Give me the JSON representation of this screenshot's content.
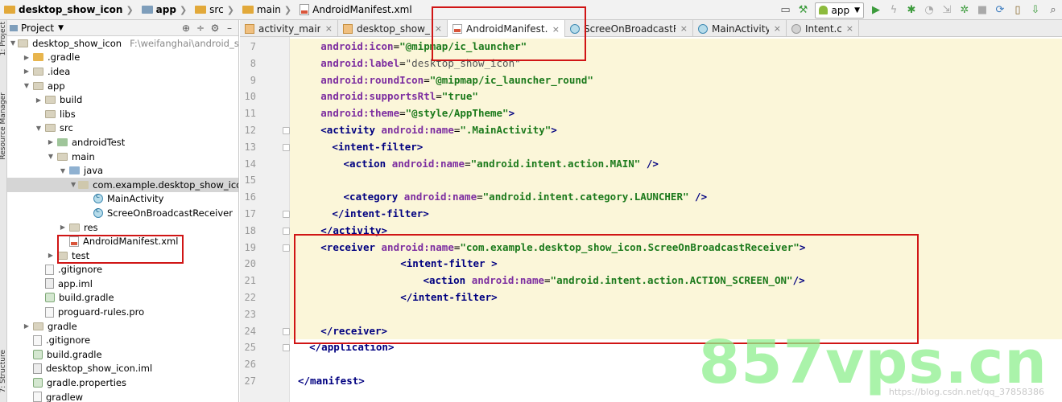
{
  "breadcrumb": [
    {
      "label": "desktop_show_icon",
      "icon": "project-folder-icon"
    },
    {
      "label": "app",
      "icon": "module-folder-icon"
    },
    {
      "label": "src",
      "icon": "folder-icon"
    },
    {
      "label": "main",
      "icon": "folder-icon"
    },
    {
      "label": "AndroidManifest.xml",
      "icon": "xml-file-icon"
    }
  ],
  "run_config": {
    "label": "app"
  },
  "project_panel": {
    "title": "Project",
    "tree": [
      {
        "label": "desktop_show_icon",
        "path": "F:\\weifanghai\\android_studio_ap",
        "icon": "folder",
        "arrow": "down",
        "indent": 0
      },
      {
        "label": ".gradle",
        "icon": "foldy",
        "arrow": "right",
        "indent": 1
      },
      {
        "label": ".idea",
        "icon": "fold",
        "arrow": "right",
        "indent": 1
      },
      {
        "label": "app",
        "icon": "fold",
        "arrow": "down",
        "indent": 1
      },
      {
        "label": "build",
        "icon": "fold",
        "arrow": "right",
        "indent": 2
      },
      {
        "label": "libs",
        "icon": "fold",
        "arrow": "none",
        "indent": 2
      },
      {
        "label": "src",
        "icon": "fold",
        "arrow": "down",
        "indent": 2
      },
      {
        "label": "androidTest",
        "icon": "foldg",
        "arrow": "right",
        "indent": 3
      },
      {
        "label": "main",
        "icon": "fold",
        "arrow": "down",
        "indent": 3
      },
      {
        "label": "java",
        "icon": "foldb",
        "arrow": "down",
        "indent": 4
      },
      {
        "label": "com.example.desktop_show_icon",
        "icon": "pkg",
        "arrow": "down",
        "indent": 5,
        "selected": true
      },
      {
        "label": "MainActivity",
        "icon": "cls",
        "arrow": "none",
        "indent": 6
      },
      {
        "label": "ScreeOnBroadcastReceiver",
        "icon": "cls",
        "arrow": "none",
        "indent": 6
      },
      {
        "label": "res",
        "icon": "fold",
        "arrow": "right",
        "indent": 4
      },
      {
        "label": "AndroidManifest.xml",
        "icon": "xml",
        "arrow": "none",
        "indent": 4
      },
      {
        "label": "test",
        "icon": "fold",
        "arrow": "right",
        "indent": 3
      },
      {
        "label": ".gitignore",
        "icon": "file",
        "arrow": "none",
        "indent": 2
      },
      {
        "label": "app.iml",
        "icon": "iml",
        "arrow": "none",
        "indent": 2
      },
      {
        "label": "build.gradle",
        "icon": "gradle",
        "arrow": "none",
        "indent": 2
      },
      {
        "label": "proguard-rules.pro",
        "icon": "file",
        "arrow": "none",
        "indent": 2
      },
      {
        "label": "gradle",
        "icon": "fold",
        "arrow": "right",
        "indent": 1
      },
      {
        "label": ".gitignore",
        "icon": "file",
        "arrow": "none",
        "indent": 1
      },
      {
        "label": "build.gradle",
        "icon": "gradle",
        "arrow": "none",
        "indent": 1
      },
      {
        "label": "desktop_show_icon.iml",
        "icon": "iml",
        "arrow": "none",
        "indent": 1
      },
      {
        "label": "gradle.properties",
        "icon": "gradle",
        "arrow": "none",
        "indent": 1
      },
      {
        "label": "gradlew",
        "icon": "file",
        "arrow": "none",
        "indent": 1
      }
    ]
  },
  "left_strip": {
    "project_tab": "1: Project",
    "resource_tab": "Resource Manager",
    "structure_tab": "7: Structure"
  },
  "tabs": [
    {
      "label": "activity_main.xml",
      "icon": "act"
    },
    {
      "label": "desktop_show_icon",
      "icon": "act"
    },
    {
      "label": "AndroidManifest.xml",
      "icon": "xml",
      "active": true
    },
    {
      "label": "ScreeOnBroadcastReceiver.java",
      "icon": "cls"
    },
    {
      "label": "MainActivity.java",
      "icon": "cls"
    },
    {
      "label": "Intent.class",
      "icon": "intent"
    }
  ],
  "code_lines": [
    {
      "n": "7",
      "indent": 4,
      "parts": [
        [
          "attr",
          "android:icon"
        ],
        [
          "txt",
          "="
        ],
        [
          "val",
          "\"@mipmap/ic_launcher\""
        ]
      ]
    },
    {
      "n": "8",
      "indent": 4,
      "parts": [
        [
          "attr",
          "android:label"
        ],
        [
          "txt",
          "="
        ],
        [
          "gray",
          "\"desktop_show_icon\""
        ]
      ]
    },
    {
      "n": "9",
      "indent": 4,
      "parts": [
        [
          "attr",
          "android:roundIcon"
        ],
        [
          "txt",
          "="
        ],
        [
          "val",
          "\"@mipmap/ic_launcher_round\""
        ]
      ]
    },
    {
      "n": "10",
      "indent": 4,
      "parts": [
        [
          "attr",
          "android:supportsRtl"
        ],
        [
          "txt",
          "="
        ],
        [
          "val",
          "\"true\""
        ]
      ]
    },
    {
      "n": "11",
      "indent": 4,
      "parts": [
        [
          "attr",
          "android:theme"
        ],
        [
          "txt",
          "="
        ],
        [
          "val",
          "\"@style/AppTheme\""
        ]
      ],
      "ends": ">"
    },
    {
      "n": "12",
      "indent": 4,
      "parts": [
        [
          "tag",
          "<activity "
        ],
        [
          "attr",
          "android:name"
        ],
        [
          "txt",
          "="
        ],
        [
          "val",
          "\".MainActivity\""
        ],
        [
          "tag",
          ">"
        ]
      ]
    },
    {
      "n": "13",
      "indent": 6,
      "parts": [
        [
          "tag",
          "<intent-filter>"
        ]
      ]
    },
    {
      "n": "14",
      "indent": 8,
      "parts": [
        [
          "tag",
          "<action "
        ],
        [
          "attr",
          "android:name"
        ],
        [
          "txt",
          "="
        ],
        [
          "val",
          "\"android.intent.action.MAIN\""
        ],
        [
          "tag",
          " />"
        ]
      ]
    },
    {
      "n": "15",
      "indent": 0,
      "parts": []
    },
    {
      "n": "16",
      "indent": 8,
      "parts": [
        [
          "tag",
          "<category "
        ],
        [
          "attr",
          "android:name"
        ],
        [
          "txt",
          "="
        ],
        [
          "val",
          "\"android.intent.category.LAUNCHER\""
        ],
        [
          "tag",
          " />"
        ]
      ]
    },
    {
      "n": "17",
      "indent": 6,
      "parts": [
        [
          "tag",
          "</intent-filter>"
        ]
      ]
    },
    {
      "n": "18",
      "indent": 4,
      "parts": [
        [
          "tag",
          "</activity>"
        ]
      ]
    },
    {
      "n": "19",
      "indent": 4,
      "parts": [
        [
          "tag",
          "<receiver "
        ],
        [
          "attr",
          "android:name"
        ],
        [
          "txt",
          "="
        ],
        [
          "val",
          "\"com.example.desktop_show_icon.ScreeOnBroadcastReceiver\""
        ],
        [
          "tag",
          ">"
        ]
      ]
    },
    {
      "n": "20",
      "indent": 18,
      "parts": [
        [
          "tag",
          "<intent-filter >"
        ]
      ]
    },
    {
      "n": "21",
      "indent": 22,
      "parts": [
        [
          "tag",
          "<action "
        ],
        [
          "attr",
          "android:name"
        ],
        [
          "txt",
          "="
        ],
        [
          "val",
          "\"android.intent.action.ACTION_SCREEN_ON\""
        ],
        [
          "tag",
          "/>"
        ]
      ]
    },
    {
      "n": "22",
      "indent": 18,
      "parts": [
        [
          "tag",
          "</intent-filter>"
        ]
      ]
    },
    {
      "n": "23",
      "indent": 0,
      "parts": []
    },
    {
      "n": "24",
      "indent": 4,
      "parts": [
        [
          "tag",
          "</receiver>"
        ]
      ]
    },
    {
      "n": "25",
      "indent": 2,
      "parts": [
        [
          "tag",
          "</application>"
        ]
      ]
    },
    {
      "n": "26",
      "indent": 0,
      "parts": []
    },
    {
      "n": "27",
      "indent": 0,
      "parts": [
        [
          "tag",
          "</manifest>"
        ]
      ]
    }
  ],
  "watermark": {
    "big": "857vps.cn",
    "small": "https://blog.csdn.net/qq_37858386"
  },
  "colors": {
    "annotation_red": "#d01515",
    "highlight": "#fbf6d9",
    "tag": "#000080",
    "attr": "#7d2ea0",
    "value": "#1c7a1c"
  }
}
